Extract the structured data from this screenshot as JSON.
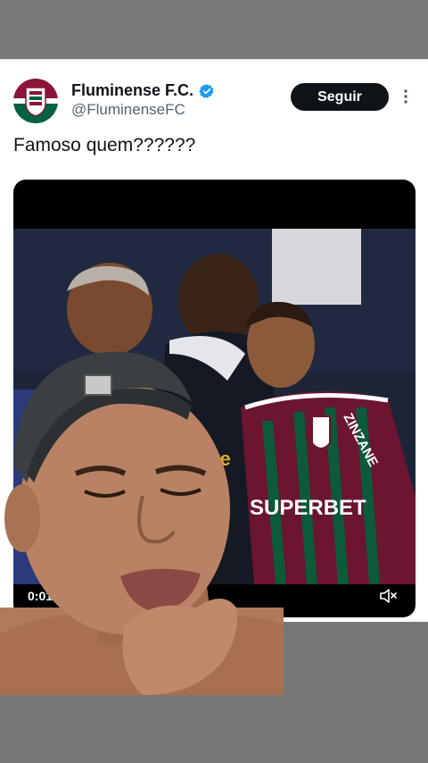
{
  "tweet": {
    "author_name": "Fluminense F.C.",
    "author_handle": "@FluminenseFC",
    "follow_label": "Seguir",
    "text": "Famoso quem??????",
    "verified": true
  },
  "video": {
    "timestamp": "0:01",
    "jersey_sponsor": "SUPERBET",
    "sleeve_text": "ZINZANE",
    "muted": true
  },
  "icons": {
    "avatar": "fluminense-crest-icon",
    "verified": "verified-badge-icon",
    "more": "more-options-icon",
    "mute": "volume-muted-icon"
  },
  "colors": {
    "fluminense_maroon": "#8a1538",
    "fluminense_green": "#006241",
    "verified_blue": "#1d9bf0",
    "follow_bg": "#0f1419"
  }
}
